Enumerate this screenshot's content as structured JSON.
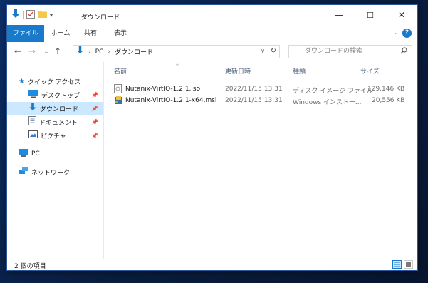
{
  "window": {
    "title": "ダウンロード",
    "tabs": [
      "ファイル",
      "ホーム",
      "共有",
      "表示"
    ],
    "controls": {
      "minimize": "—",
      "maximize": "☐",
      "close": "✕"
    },
    "accent": "#1979ca"
  },
  "address": {
    "segments": [
      "PC",
      "ダウンロード"
    ],
    "search_placeholder": "ダウンロードの検索"
  },
  "nav": {
    "quick_access": "クイック アクセス",
    "items": [
      {
        "label": "デスクトップ",
        "icon": "desktop-icon",
        "pinned": true
      },
      {
        "label": "ダウンロード",
        "icon": "download-icon",
        "pinned": true,
        "selected": true
      },
      {
        "label": "ドキュメント",
        "icon": "document-icon",
        "pinned": true
      },
      {
        "label": "ピクチャ",
        "icon": "picture-icon",
        "pinned": true
      }
    ],
    "pc": "PC",
    "network": "ネットワーク"
  },
  "columns": [
    "名前",
    "更新日時",
    "種類",
    "サイズ"
  ],
  "files": [
    {
      "name": "Nutanix-VirtIO-1.2.1.iso",
      "modified": "2022/11/15 13:31",
      "type": "ディスク イメージ ファイル",
      "size": "129,146 KB",
      "icon": "disc-image-icon"
    },
    {
      "name": "Nutanix-VirtIO-1.2.1-x64.msi",
      "modified": "2022/11/15 13:31",
      "type": "Windows インストー...",
      "size": "20,556 KB",
      "icon": "installer-icon"
    }
  ],
  "status": {
    "item_count": "2 個の項目"
  }
}
